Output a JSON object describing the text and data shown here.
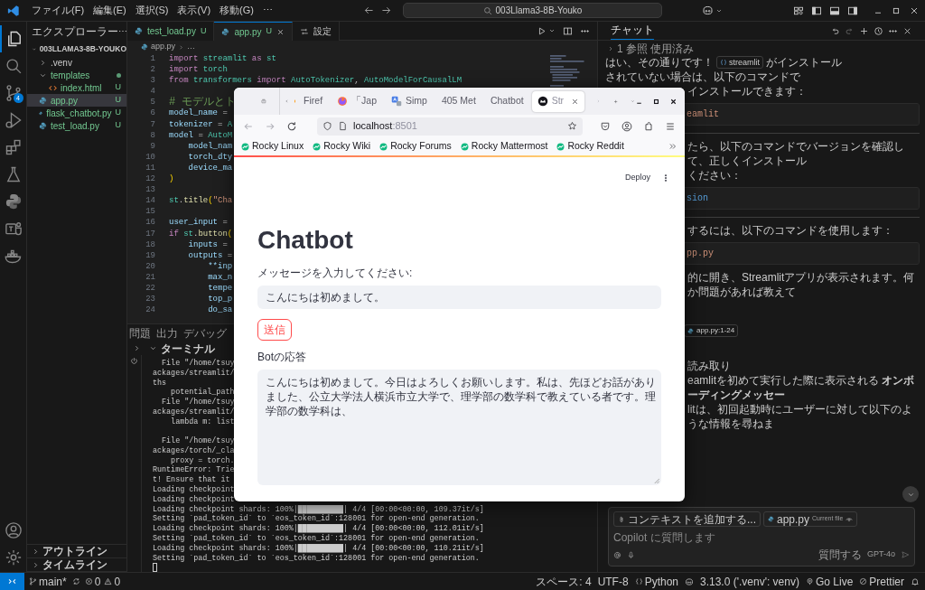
{
  "title_bar": {
    "menus": [
      "ファイル(F)",
      "編集(E)",
      "選択(S)",
      "表示(V)",
      "移動(G)",
      "⋯"
    ],
    "command_center": "003Llama3-8B-Youko"
  },
  "activity_bar": {
    "items": [
      {
        "kind": "explorer",
        "selected": true
      },
      {
        "kind": "search",
        "selected": false
      },
      {
        "kind": "source_control",
        "selected": false,
        "badge": "4"
      },
      {
        "kind": "run",
        "selected": false
      },
      {
        "kind": "extensions",
        "selected": false
      },
      {
        "kind": "testing",
        "selected": false
      },
      {
        "kind": "python",
        "selected": false
      },
      {
        "kind": "teams",
        "selected": false
      },
      {
        "kind": "docker",
        "selected": false
      }
    ],
    "bottom": [
      {
        "kind": "account"
      },
      {
        "kind": "settings"
      }
    ]
  },
  "sidebar": {
    "title": "エクスプローラー",
    "more": "⋯",
    "root": {
      "label": "003LLAMA3-8B-YOUKO",
      "expanded": true,
      "children": [
        {
          "label": ".venv",
          "kind": "folder",
          "expanded": false,
          "selected": false
        },
        {
          "label": "templates",
          "kind": "folder",
          "expanded": true,
          "selected": false,
          "changes": true,
          "children": [
            {
              "label": "index.html",
              "kind": "html",
              "badge": "U",
              "selected": false
            }
          ]
        },
        {
          "label": "app.py",
          "kind": "python",
          "badge": "U",
          "selected": true
        },
        {
          "label": "flask_chatbot.py",
          "kind": "python",
          "badge": "U",
          "selected": false
        },
        {
          "label": "test_load.py",
          "kind": "python",
          "badge": "U",
          "selected": false
        }
      ]
    },
    "sections": [
      {
        "label": "アウトライン",
        "expanded": false
      },
      {
        "label": "タイムライン",
        "expanded": false
      }
    ]
  },
  "editor": {
    "tabs": [
      {
        "label": "test_load.py",
        "badge": "U",
        "kind": "python",
        "selected": false
      },
      {
        "label": "app.py",
        "badge": "U",
        "kind": "python",
        "selected": true
      },
      {
        "label": "設定",
        "kind": "settings",
        "selected": false
      }
    ],
    "breadcrumb": [
      "app.py",
      "…"
    ],
    "lines": [
      {
        "n": "1",
        "t": [
          {
            "text": "import",
            "kind": "keyword"
          },
          {
            "text": " streamlit ",
            "kind": "module"
          },
          {
            "text": "as",
            "kind": "keyword"
          },
          {
            "text": " st",
            "kind": "module"
          }
        ]
      },
      {
        "n": "2",
        "t": [
          {
            "text": "import",
            "kind": "keyword"
          },
          {
            "text": " torch",
            "kind": "module"
          }
        ]
      },
      {
        "n": "3",
        "t": [
          {
            "text": "from",
            "kind": "keyword"
          },
          {
            "text": " transformers ",
            "kind": "module"
          },
          {
            "text": "import",
            "kind": "keyword"
          },
          {
            "text": " AutoTokenizer",
            "kind": "module"
          },
          {
            "text": ", ",
            "kind": "plain"
          },
          {
            "text": "AutoModelForCausalLM",
            "kind": "module"
          }
        ]
      },
      {
        "n": "4"
      },
      {
        "n": "5",
        "t": [
          {
            "text": "# モデルとト",
            "kind": "comment"
          }
        ]
      },
      {
        "n": "6",
        "t": [
          {
            "text": "model_name",
            "kind": "variable"
          },
          {
            "text": " =",
            "kind": "plain"
          }
        ]
      },
      {
        "n": "7",
        "t": [
          {
            "text": "tokenizer",
            "kind": "variable"
          },
          {
            "text": " = ",
            "kind": "plain"
          },
          {
            "text": "A",
            "kind": "module"
          }
        ]
      },
      {
        "n": "8",
        "t": [
          {
            "text": "model",
            "kind": "variable"
          },
          {
            "text": " = ",
            "kind": "plain"
          },
          {
            "text": "AutoM",
            "kind": "module"
          }
        ]
      },
      {
        "n": "9",
        "t": [
          {
            "text": "    model_nam",
            "kind": "variable"
          }
        ]
      },
      {
        "n": "10",
        "t": [
          {
            "text": "    torch_dty",
            "kind": "variable"
          }
        ]
      },
      {
        "n": "11",
        "t": [
          {
            "text": "    device_ma",
            "kind": "variable"
          }
        ]
      },
      {
        "n": "12",
        "t": [
          {
            "text": ")",
            "kind": "bracket"
          }
        ]
      },
      {
        "n": "13"
      },
      {
        "n": "14",
        "t": [
          {
            "text": "st",
            "kind": "module"
          },
          {
            "text": ".",
            "kind": "plain"
          },
          {
            "text": "title",
            "kind": "function"
          },
          {
            "text": "(",
            "kind": "bracket"
          },
          {
            "text": "\"Cha",
            "kind": "string"
          }
        ]
      },
      {
        "n": "15"
      },
      {
        "n": "16",
        "t": [
          {
            "text": "user_input",
            "kind": "variable"
          },
          {
            "text": " =",
            "kind": "plain"
          }
        ]
      },
      {
        "n": "17",
        "t": [
          {
            "text": "if ",
            "kind": "keyword"
          },
          {
            "text": "st",
            "kind": "module"
          },
          {
            "text": ".",
            "kind": "plain"
          },
          {
            "text": "button",
            "kind": "function"
          },
          {
            "text": "(",
            "kind": "bracket"
          }
        ]
      },
      {
        "n": "18",
        "t": [
          {
            "text": "    inputs",
            "kind": "variable"
          },
          {
            "text": " =",
            "kind": "plain"
          }
        ]
      },
      {
        "n": "19",
        "t": [
          {
            "text": "    outputs",
            "kind": "variable"
          },
          {
            "text": " =",
            "kind": "plain"
          }
        ]
      },
      {
        "n": "20",
        "t": [
          {
            "text": "        **inp",
            "kind": "variable"
          }
        ]
      },
      {
        "n": "21",
        "t": [
          {
            "text": "        max_n",
            "kind": "variable"
          }
        ]
      },
      {
        "n": "22",
        "t": [
          {
            "text": "        tempe",
            "kind": "variable"
          }
        ]
      },
      {
        "n": "23",
        "t": [
          {
            "text": "        top_p",
            "kind": "variable"
          }
        ]
      },
      {
        "n": "24",
        "t": [
          {
            "text": "        do_sa",
            "kind": "variable"
          }
        ]
      }
    ]
  },
  "panel": {
    "tabs": [
      {
        "label": "問題",
        "selected": false
      },
      {
        "label": "出力",
        "selected": false
      },
      {
        "label": "デバッグ",
        "selected": false
      }
    ],
    "terminal": {
      "title": "ターミナル",
      "expanded": true,
      "lines": [
        {
          "kind": "text",
          "text": "  File \"/home/tsuy"
        },
        {
          "kind": "text",
          "text": "ackages/streamlit/"
        },
        {
          "kind": "text",
          "text": "ths"
        },
        {
          "kind": "text",
          "text": "    potential_path"
        },
        {
          "kind": "text",
          "text": "  File \"/home/tsuy"
        },
        {
          "kind": "text",
          "text": "ackages/streamlit/"
        },
        {
          "kind": "text",
          "text": "    lambda m: list"
        },
        {
          "kind": "blank"
        },
        {
          "kind": "text",
          "text": "  File \"/home/tsuy"
        },
        {
          "kind": "text",
          "text": "ackages/torch/_cla"
        },
        {
          "kind": "text",
          "text": "    proxy = torch."
        },
        {
          "kind": "text",
          "text": "RuntimeError: Trie"
        },
        {
          "kind": "text",
          "text": "t! Ensure that it"
        },
        {
          "kind": "text",
          "text": "Loading checkpoint"
        },
        {
          "kind": "text",
          "text": "Loading checkpoint"
        },
        {
          "kind": "text",
          "text": "Loading checkpoint shards: 100%|██████████| 4/4 [00:00<00:00, 109.37it/s]"
        },
        {
          "kind": "text",
          "text": "Setting `pad_token_id` to `eos_token_id`:128001 for open-end generation."
        },
        {
          "kind": "text",
          "text": "Loading checkpoint shards: 100%|██████████| 4/4 [00:00<00:00, 112.01it/s]"
        },
        {
          "kind": "text",
          "text": "Setting `pad_token_id` to `eos_token_id`:128001 for open-end generation."
        },
        {
          "kind": "text",
          "text": "Loading checkpoint shards: 100%|██████████| 4/4 [00:00<00:00, 110.21it/s]"
        },
        {
          "kind": "text",
          "text": "Setting `pad_token_id` to `eos_token_id`:128001 for open-end generation."
        },
        {
          "kind": "cursor"
        }
      ]
    }
  },
  "chat": {
    "title": "チャット",
    "blocks": [
      {
        "kind": "refs",
        "text": "1 参照 使用済み"
      },
      {
        "kind": "line",
        "text": "はい、その通りです！",
        "chip": "streamlit",
        "after": "がインストール"
      },
      {
        "kind": "line",
        "text": "されていない場合は、以下のコマンドで"
      },
      {
        "kind": "tail",
        "text": "インストールできます："
      },
      {
        "kind": "code",
        "tokens": [
          {
            "text": "eamlit",
            "kind": "string"
          }
        ]
      },
      {
        "kind": "divider"
      },
      {
        "kind": "tail",
        "text": "たら、以下のコマンドでバージョンを確認して、正しくインストール"
      },
      {
        "kind": "tail",
        "text": "ください："
      },
      {
        "kind": "code",
        "tokens": [
          {
            "text": "sion",
            "kind": "option"
          }
        ]
      },
      {
        "kind": "divider"
      },
      {
        "kind": "tail",
        "text": "するには、以下のコマンドを使用します："
      },
      {
        "kind": "code",
        "tokens": [
          {
            "text": "pp.py",
            "kind": "string"
          }
        ]
      },
      {
        "kind": "tail",
        "text": "的に開き、Streamlitアプリが表示されます。何か問題があれば教えて"
      },
      {
        "kind": "file_chip",
        "text": "app.py:1-24"
      },
      {
        "kind": "tail",
        "text": "読み取り"
      },
      {
        "kind": "tail",
        "text": "eamlitを初めて実行した際に表示される **オンボーディングメッセー**"
      },
      {
        "kind": "tail",
        "text": "litは、初回起動時にユーザーに対して以下のような情報を尋ねま"
      }
    ],
    "input": {
      "chips": [
        {
          "kind": "attach",
          "label": "コンテキストを追加する..."
        },
        {
          "kind": "file",
          "label": "app.py",
          "sub": "Current file"
        }
      ],
      "placeholder": "Copilot に質問します",
      "mode": "質問する",
      "model": "GPT-4o"
    }
  },
  "status_bar": {
    "branch": "main*",
    "errors": "0",
    "warnings": "0",
    "right": [
      {
        "kind": "text",
        "text": "スペース: 4"
      },
      {
        "kind": "text",
        "text": "UTF-8"
      },
      {
        "kind": "language",
        "text": "Python"
      },
      {
        "kind": "env",
        "text": "3.13.0 ('.venv': venv)"
      },
      {
        "kind": "golive",
        "text": "Go Live"
      },
      {
        "kind": "prettier",
        "text": "Prettier"
      },
      {
        "kind": "bell"
      }
    ]
  },
  "browser": {
    "tabs": [
      {
        "kind": "partial",
        "label": "Firef",
        "selected": false
      },
      {
        "kind": "firefox",
        "label": "「Jap",
        "selected": false
      },
      {
        "kind": "translate",
        "label": "Simp",
        "selected": false
      },
      {
        "kind": "none",
        "label": "405 Met",
        "selected": false
      },
      {
        "kind": "none",
        "label": "Chatbot",
        "selected": false
      },
      {
        "kind": "streamlit",
        "label": "Str",
        "selected": true
      }
    ],
    "url_host": "localhost",
    "url_port": ":8501",
    "bookmarks": [
      "Rocky Linux",
      "Rocky Wiki",
      "Rocky Forums",
      "Rocky Mattermost",
      "Rocky Reddit"
    ],
    "page": {
      "deploy": "Deploy",
      "title": "Chatbot",
      "input_label": "メッセージを入力してください:",
      "input_value": "こんにちは初めまして。",
      "button": "送信",
      "output_label": "Botの応答",
      "output_value": "こんにちは初めまして。今日はよろしくお願いします。私は、先ほどお話がありました、公立大学法人横浜市立大学で、理学部の数学科で教えている者です。理学部の数学科は、"
    }
  }
}
